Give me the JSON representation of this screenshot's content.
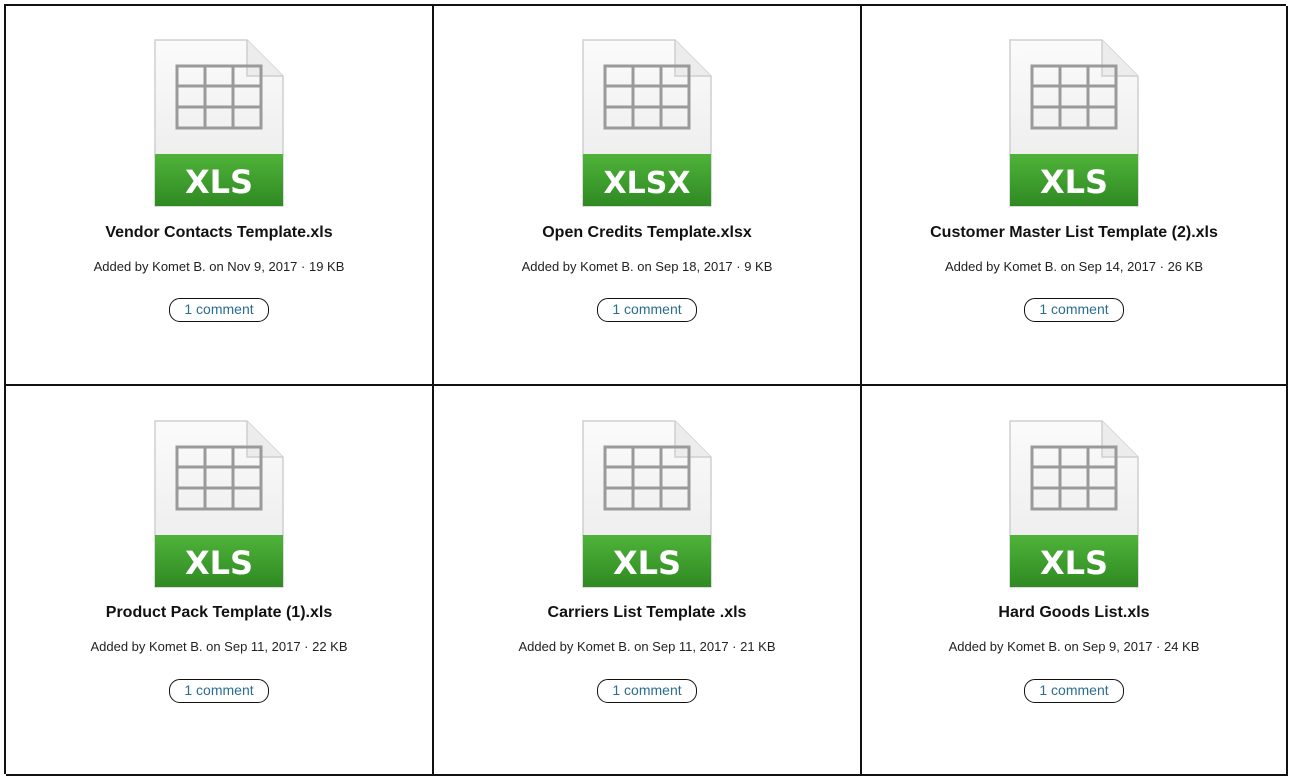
{
  "files": [
    {
      "name": "Vendor Contacts Template.xls",
      "ext_label": "XLS",
      "meta": "Added by Komet B. on Nov 9, 2017 · 19 KB",
      "comments": "1 comment"
    },
    {
      "name": "Open Credits Template.xlsx",
      "ext_label": "XLSX",
      "meta": "Added by Komet B. on Sep 18, 2017 · 9 KB",
      "comments": "1 comment"
    },
    {
      "name": "Customer Master List Template (2).xls",
      "ext_label": "XLS",
      "meta": "Added by Komet B. on Sep 14, 2017 · 26 KB",
      "comments": "1 comment"
    },
    {
      "name": "Product Pack Template (1).xls",
      "ext_label": "XLS",
      "meta": "Added by Komet B. on Sep 11, 2017 · 22 KB",
      "comments": "1 comment"
    },
    {
      "name": "Carriers List Template .xls",
      "ext_label": "XLS",
      "meta": "Added by Komet B. on Sep 11, 2017 · 21 KB",
      "comments": "1 comment"
    },
    {
      "name": "Hard Goods List.xls",
      "ext_label": "XLS",
      "meta": "Added by Komet B. on Sep 9, 2017 · 24 KB",
      "comments": "1 comment"
    }
  ],
  "icon": {
    "name": "spreadsheet-file-icon",
    "band_color": "#3a9d2a",
    "label_color": "#ffffff"
  }
}
